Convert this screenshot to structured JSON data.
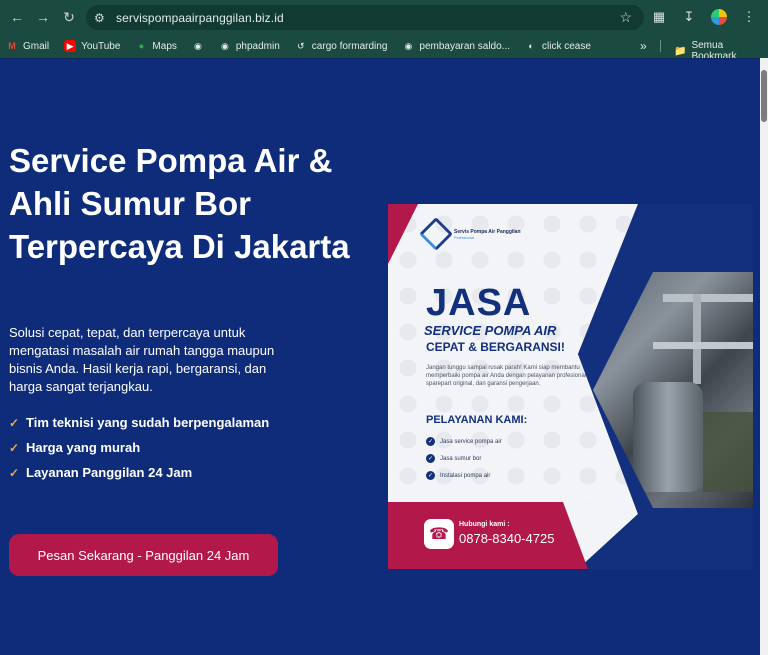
{
  "browser": {
    "url": "servispompaairpanggilan.biz.id",
    "bookmarks": [
      {
        "label": "Gmail",
        "icon": "gmail-icon"
      },
      {
        "label": "YouTube",
        "icon": "youtube-icon"
      },
      {
        "label": "Maps",
        "icon": "maps-icon"
      },
      {
        "label": "",
        "icon": "globe-icon"
      },
      {
        "label": "phpadmin",
        "icon": "globe-icon"
      },
      {
        "label": "cargo formarding",
        "icon": "history-icon"
      },
      {
        "label": "pembayaran saldo...",
        "icon": "globe-icon"
      },
      {
        "label": "click cease",
        "icon": "loading-icon"
      }
    ],
    "all_bookmarks": "Semua Bookmark"
  },
  "hero": {
    "title": "Service Pompa Air & Ahli Sumur Bor Terpercaya Di Jakarta",
    "description": "Solusi cepat, tepat, dan terpercaya untuk mengatasi masalah air rumah tangga maupun bisnis Anda. Hasil kerja rapi, bergaransi, dan harga sangat terjangkau.",
    "features": [
      "Tim teknisi yang sudah berpengalaman",
      "Harga yang murah",
      "Layanan Panggilan 24 Jam"
    ],
    "cta": "Pesan Sekarang - Panggilan 24 Jam"
  },
  "poster": {
    "brand": "Servis Pompa Air Panggilan",
    "brand_sub": "Profesional",
    "headline": "JASA",
    "line1": "SERVICE POMPA AIR",
    "line2": "CEPAT & BERGARANSI!",
    "desc": "Jangan tunggu sampai rusak parah! Kami siap membantu memperbaiki pompa air Anda dengan pelayanan profesional, sparepart original, dan garansi pengerjaan.",
    "services_title": "PELAYANAN KAMI:",
    "services": [
      "Jasa service pompa air",
      "Jasa sumur bor",
      "Instalasi pompa air"
    ],
    "contact_label": "Hubungi kami :",
    "phone": "0878-8340-4725"
  },
  "colors": {
    "page_bg": "#0e2c7a",
    "accent_red": "#b3184a",
    "check": "#f0a840",
    "chrome": "#1b4a40"
  }
}
